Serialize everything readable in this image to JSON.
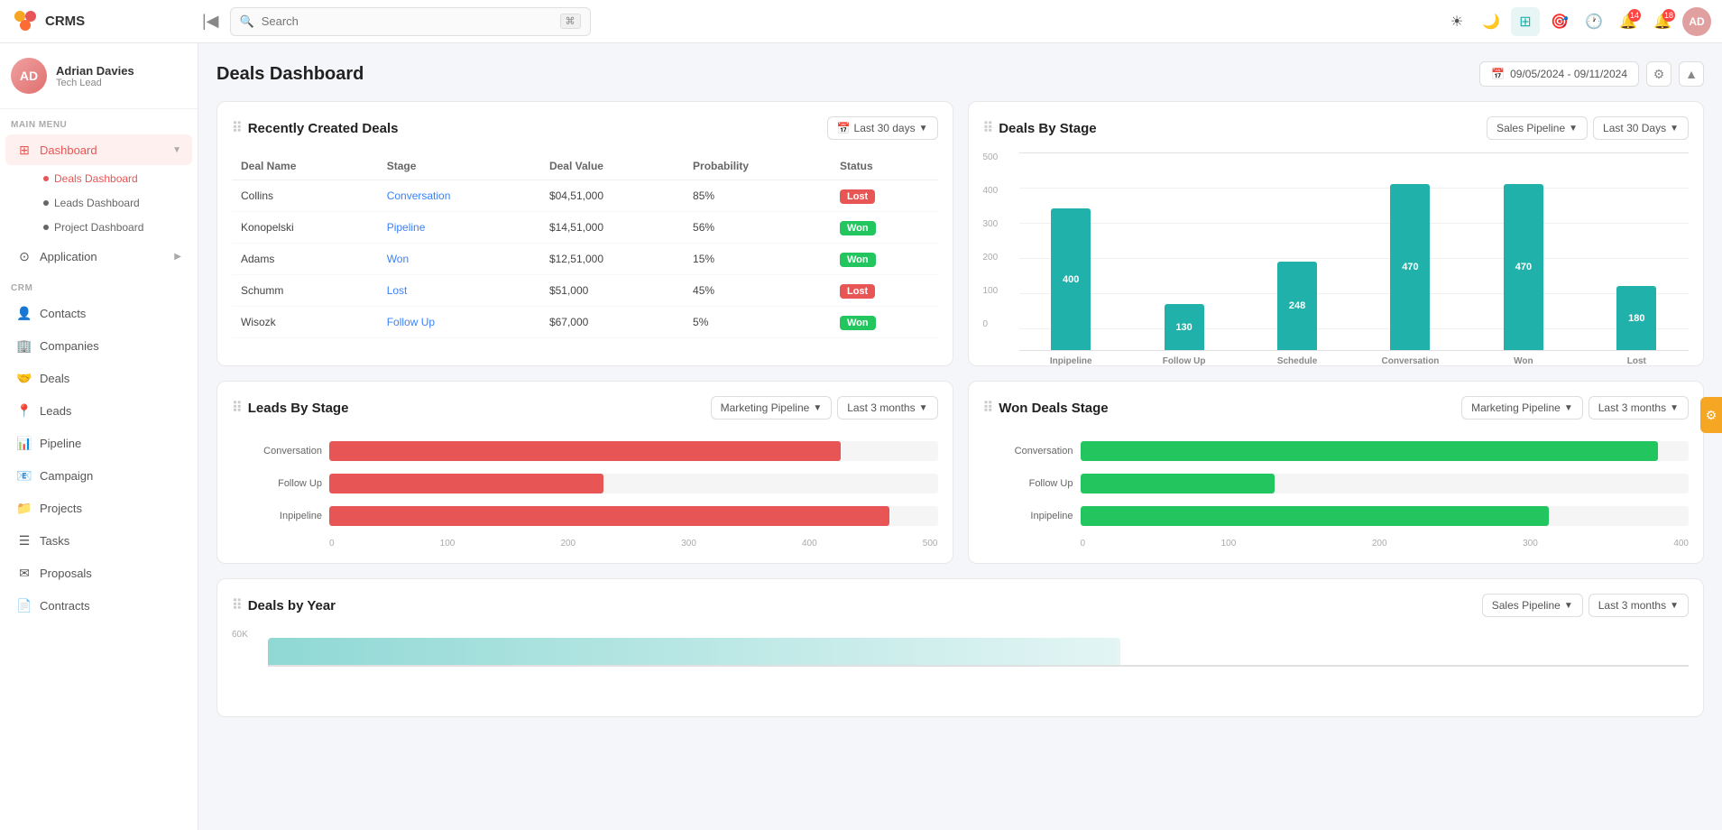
{
  "topbar": {
    "logo_text": "CRMS",
    "search_placeholder": "Search",
    "search_kbd": "⌘",
    "icons": [
      "sun-icon",
      "moon-icon",
      "grid-icon",
      "target-icon",
      "clock-icon"
    ],
    "notification_count_1": "14",
    "notification_count_2": "18",
    "collapse_btn": "|◀"
  },
  "sidebar": {
    "profile": {
      "name": "Adrian Davies",
      "role": "Tech Lead",
      "initials": "AD"
    },
    "main_menu_label": "MAIN MENU",
    "crm_label": "CRM",
    "nav_items": [
      {
        "id": "dashboard",
        "label": "Dashboard",
        "icon": "⊞",
        "active": true,
        "has_children": true
      },
      {
        "id": "application",
        "label": "Application",
        "icon": "⊙",
        "active": false,
        "has_children": true
      }
    ],
    "dashboard_children": [
      {
        "id": "deals-dashboard",
        "label": "Deals Dashboard",
        "active": true
      },
      {
        "id": "leads-dashboard",
        "label": "Leads Dashboard",
        "active": false
      },
      {
        "id": "project-dashboard",
        "label": "Project Dashboard",
        "active": false
      }
    ],
    "crm_items": [
      {
        "id": "contacts",
        "label": "Contacts",
        "icon": "👤"
      },
      {
        "id": "companies",
        "label": "Companies",
        "icon": "🏢"
      },
      {
        "id": "deals",
        "label": "Deals",
        "icon": "🤝"
      },
      {
        "id": "leads",
        "label": "Leads",
        "icon": "📍"
      },
      {
        "id": "pipeline",
        "label": "Pipeline",
        "icon": "📊"
      },
      {
        "id": "campaign",
        "label": "Campaign",
        "icon": "📧"
      },
      {
        "id": "projects",
        "label": "Projects",
        "icon": "📁"
      },
      {
        "id": "tasks",
        "label": "Tasks",
        "icon": "☰"
      },
      {
        "id": "proposals",
        "label": "Proposals",
        "icon": "✉"
      },
      {
        "id": "contracts",
        "label": "Contracts",
        "icon": "📄"
      }
    ]
  },
  "page": {
    "title": "Deals Dashboard",
    "date_range": "09/05/2024 - 09/11/2024"
  },
  "recently_created_deals": {
    "title": "Recently Created Deals",
    "filter_label": "Last 30 days",
    "columns": [
      "Deal Name",
      "Stage",
      "Deal Value",
      "Probability",
      "Status"
    ],
    "rows": [
      {
        "name": "Collins",
        "stage": "Conversation",
        "value": "$04,51,000",
        "probability": "85%",
        "status": "Lost",
        "status_type": "lost"
      },
      {
        "name": "Konopelski",
        "stage": "Pipeline",
        "value": "$14,51,000",
        "probability": "56%",
        "status": "Won",
        "status_type": "won"
      },
      {
        "name": "Adams",
        "stage": "Won",
        "value": "$12,51,000",
        "probability": "15%",
        "status": "Won",
        "status_type": "won"
      },
      {
        "name": "Schumm",
        "stage": "Lost",
        "value": "$51,000",
        "probability": "45%",
        "status": "Lost",
        "status_type": "lost"
      },
      {
        "name": "Wisozk",
        "stage": "Follow Up",
        "value": "$67,000",
        "probability": "5%",
        "status": "Won",
        "status_type": "won"
      }
    ]
  },
  "deals_by_stage": {
    "title": "Deals By Stage",
    "pipeline_filter": "Sales Pipeline",
    "time_filter": "Last 30 Days",
    "y_labels": [
      "0",
      "100",
      "200",
      "300",
      "400",
      "500"
    ],
    "bars": [
      {
        "label": "Inpipeline",
        "value": 400,
        "height_pct": 80
      },
      {
        "label": "Follow Up",
        "value": 130,
        "height_pct": 26
      },
      {
        "label": "Schedule",
        "value": 248,
        "height_pct": 50
      },
      {
        "label": "Conversation",
        "value": 470,
        "height_pct": 94
      },
      {
        "label": "Won",
        "value": 470,
        "height_pct": 94
      },
      {
        "label": "Lost",
        "value": 180,
        "height_pct": 36
      }
    ]
  },
  "leads_by_stage": {
    "title": "Leads By Stage",
    "pipeline_filter": "Marketing Pipeline",
    "time_filter": "Last 3 months",
    "bars": [
      {
        "label": "Conversation",
        "value": 420,
        "width_pct": 84
      },
      {
        "label": "Follow Up",
        "value": 225,
        "width_pct": 45
      },
      {
        "label": "Inpipeline",
        "value": 460,
        "width_pct": 92
      }
    ],
    "x_labels": [
      "0",
      "100",
      "200",
      "300",
      "400",
      "500"
    ]
  },
  "won_deals_stage": {
    "title": "Won Deals Stage",
    "pipeline_filter": "Marketing Pipeline",
    "time_filter": "Last 3 months",
    "bars": [
      {
        "label": "Conversation",
        "value": 380,
        "width_pct": 95
      },
      {
        "label": "Follow Up",
        "value": 130,
        "width_pct": 32
      },
      {
        "label": "Inpipeline",
        "value": 310,
        "width_pct": 77
      }
    ],
    "x_labels": [
      "0",
      "100",
      "200",
      "300",
      "400"
    ]
  },
  "deals_by_year": {
    "title": "Deals by Year",
    "pipeline_filter": "Sales Pipeline",
    "time_filter": "Last 3 months",
    "y_label": "60K"
  }
}
